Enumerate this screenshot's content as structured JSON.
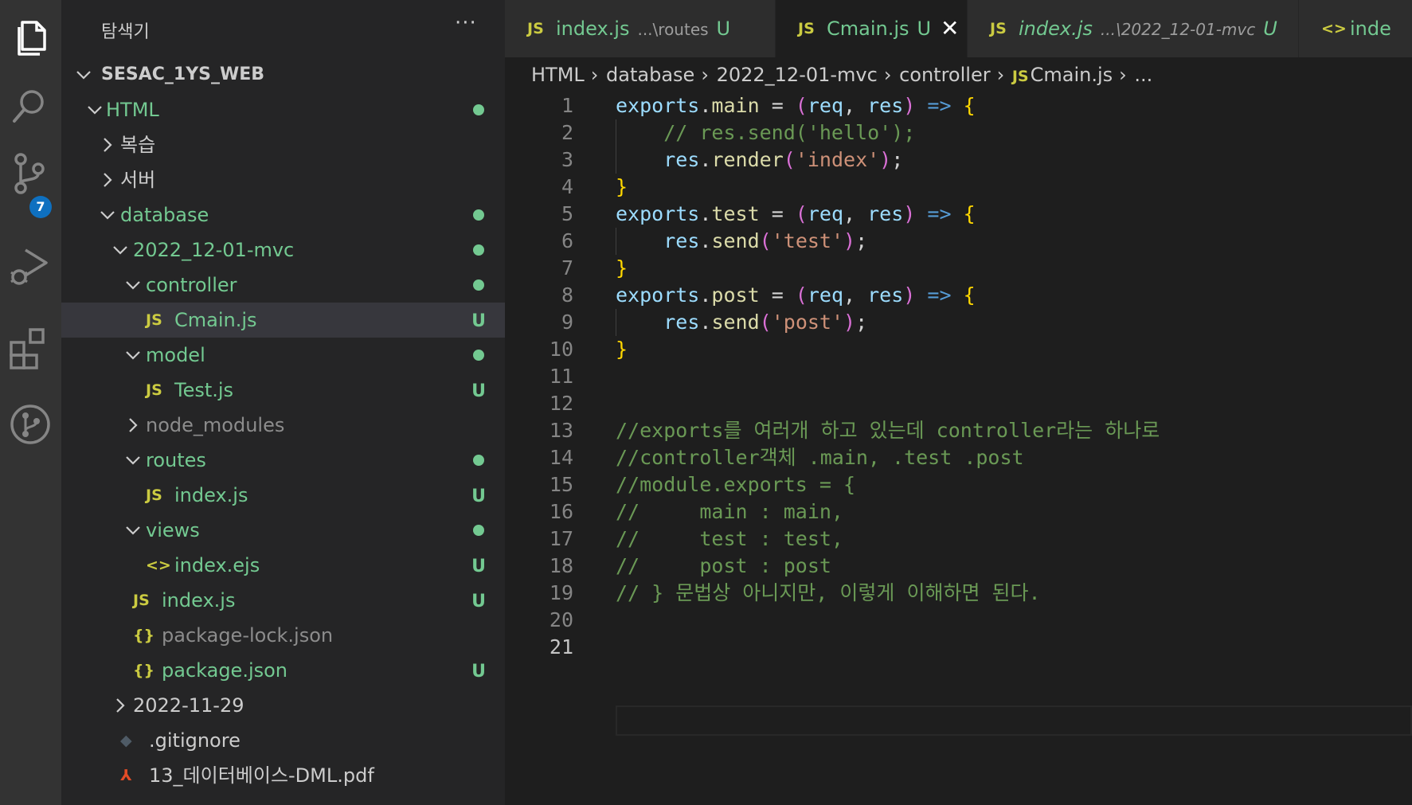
{
  "sidebar": {
    "title": "탐색기",
    "more": "···",
    "root": "SESAC_1YS_WEB",
    "items": [
      {
        "label": "HTML",
        "kind": "folder-open",
        "color": "green",
        "status": "dot"
      },
      {
        "label": "복습",
        "kind": "folder-closed",
        "color": "white",
        "status": ""
      },
      {
        "label": "서버",
        "kind": "folder-closed",
        "color": "white",
        "status": ""
      },
      {
        "label": "database",
        "kind": "folder-open",
        "color": "green",
        "status": "dot"
      },
      {
        "label": "2022_12-01-mvc",
        "kind": "folder-open",
        "color": "green",
        "status": "dot"
      },
      {
        "label": "controller",
        "kind": "folder-open",
        "color": "green",
        "status": "dot"
      },
      {
        "label": "Cmain.js",
        "kind": "js",
        "color": "green",
        "status": "U"
      },
      {
        "label": "model",
        "kind": "folder-open",
        "color": "green",
        "status": "dot"
      },
      {
        "label": "Test.js",
        "kind": "js",
        "color": "green",
        "status": "U"
      },
      {
        "label": "node_modules",
        "kind": "folder-closed",
        "color": "gray",
        "status": ""
      },
      {
        "label": "routes",
        "kind": "folder-open",
        "color": "green",
        "status": "dot"
      },
      {
        "label": "index.js",
        "kind": "js",
        "color": "green",
        "status": "U"
      },
      {
        "label": "views",
        "kind": "folder-open",
        "color": "green",
        "status": "dot"
      },
      {
        "label": "index.ejs",
        "kind": "ejs",
        "color": "green",
        "status": "U"
      },
      {
        "label": "index.js",
        "kind": "js",
        "color": "green",
        "status": "U"
      },
      {
        "label": "package-lock.json",
        "kind": "json",
        "color": "gray",
        "status": ""
      },
      {
        "label": "package.json",
        "kind": "json",
        "color": "green",
        "status": "U"
      },
      {
        "label": "2022-11-29",
        "kind": "folder-closed",
        "color": "white",
        "status": ""
      },
      {
        "label": ".gitignore",
        "kind": "git",
        "color": "white",
        "status": ""
      },
      {
        "label": "13_데이터베이스-DML.pdf",
        "kind": "pdf",
        "color": "white",
        "status": ""
      }
    ]
  },
  "activity": {
    "scm_badge": "7"
  },
  "tabs": [
    {
      "icon": "JS",
      "label": "index.js",
      "desc": "...\\routes",
      "status": "U"
    },
    {
      "icon": "JS",
      "label": "Cmain.js",
      "desc": "",
      "status": "U",
      "close": "✕"
    },
    {
      "icon": "JS",
      "label": "index.js",
      "desc": "...\\2022_12-01-mvc",
      "status": "U"
    },
    {
      "icon": "<>",
      "label": "inde"
    }
  ],
  "breadcrumb": {
    "items": [
      "HTML",
      "database",
      "2022_12-01-mvc",
      "controller"
    ],
    "file_icon": "JS",
    "file": "Cmain.js",
    "tail": "..."
  },
  "editor": {
    "line_numbers": [
      "1",
      "2",
      "3",
      "4",
      "5",
      "6",
      "7",
      "8",
      "9",
      "10",
      "11",
      "12",
      "13",
      "14",
      "15",
      "16",
      "17",
      "18",
      "19",
      "20",
      "21"
    ],
    "comments": {
      "l2": "// res.send('hello');",
      "l13": "//exports를 여러개 하고 있는데 controller라는 하나로",
      "l14": "//controller객체 .main, .test .post",
      "l15": "//module.exports = {",
      "l16": "//     main : main,",
      "l17": "//     test : test,",
      "l18": "//     post : post",
      "l19": "// } 문법상 아니지만, 이렇게 이해하면 된다."
    },
    "tokens": {
      "exports": "exports",
      "main": "main",
      "test": "test",
      "post": "post",
      "req": "req",
      "res": "res",
      "render": "render",
      "send": "send",
      "s_index": "'index'",
      "s_test": "'test'",
      "s_post": "'post'"
    }
  }
}
